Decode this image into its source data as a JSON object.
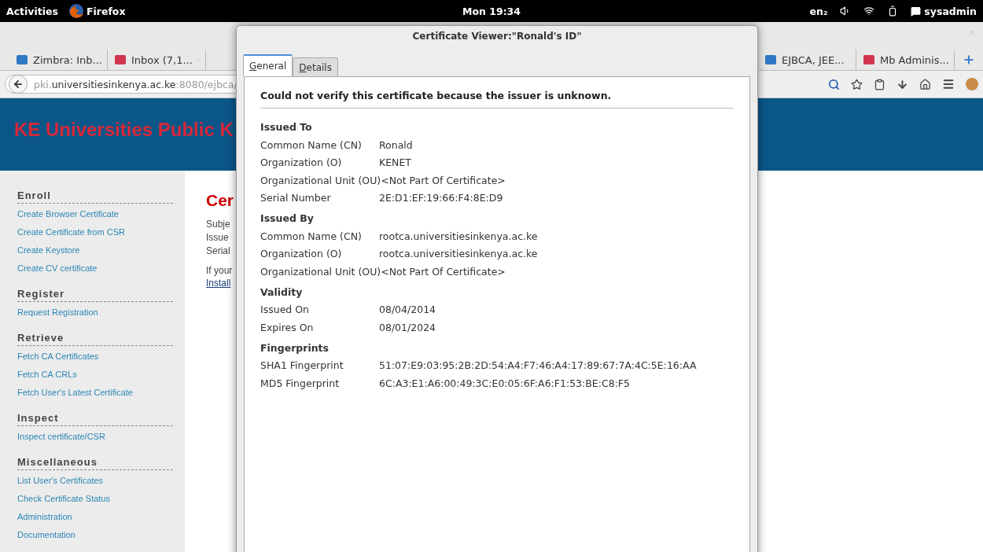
{
  "top_bar": {
    "activities": "Activities",
    "app_name": "Firefox",
    "clock": "Mon 19:34",
    "keyboard_layout": "en₂",
    "user": "sysadmin"
  },
  "browser": {
    "tabs_left": [
      {
        "label": "Zimbra: Inb...",
        "selected": false
      },
      {
        "label": "Inbox (7,1...",
        "selected": false
      }
    ],
    "tabs_right": [
      {
        "label": "EJBCA, JEE...",
        "selected": false
      },
      {
        "label": "Mb Adminis...",
        "selected": false
      }
    ],
    "url": "pki.**universitiesinkenya.ac.ke**:8080/ejbca/"
  },
  "site": {
    "banner_title": "KE Universities Public K",
    "sidebar": [
      {
        "heading": "Enroll",
        "links": [
          "Create Browser Certificate",
          "Create Certificate from CSR",
          "Create Keystore",
          "Create CV certificate"
        ]
      },
      {
        "heading": "Register",
        "links": [
          "Request Registration"
        ]
      },
      {
        "heading": "Retrieve",
        "links": [
          "Fetch CA Certificates",
          "Fetch CA CRLs",
          "Fetch User's Latest Certificate"
        ]
      },
      {
        "heading": "Inspect",
        "links": [
          "Inspect certificate/CSR"
        ]
      },
      {
        "heading": "Miscellaneous",
        "links": [
          "List User's Certificates",
          "Check Certificate Status",
          "Administration",
          "Documentation"
        ]
      }
    ],
    "main": {
      "heading": "Cer",
      "lines": [
        "Subje",
        "Issue",
        "Serial"
      ],
      "note": "If your",
      "link": "Install"
    }
  },
  "dialog": {
    "title": "Certificate Viewer:\"Ronald's ID\"",
    "tabs": [
      {
        "label": "General",
        "selected": true
      },
      {
        "label": "Details",
        "selected": false
      }
    ],
    "message": "Could not verify this certificate because the issuer is unknown.",
    "sections": [
      {
        "heading": "Issued To",
        "rows": [
          {
            "label": "Common Name (CN)",
            "value": "Ronald"
          },
          {
            "label": "Organization (O)",
            "value": "KENET"
          },
          {
            "label": "Organizational Unit (OU)",
            "value": "<Not Part Of Certificate>"
          },
          {
            "label": "Serial Number",
            "value": "2E:D1:EF:19:66:F4:8E:D9"
          }
        ]
      },
      {
        "heading": "Issued By",
        "rows": [
          {
            "label": "Common Name (CN)",
            "value": "rootca.universitiesinkenya.ac.ke"
          },
          {
            "label": "Organization (O)",
            "value": "rootca.universitiesinkenya.ac.ke"
          },
          {
            "label": "Organizational Unit (OU)",
            "value": "<Not Part Of Certificate>"
          }
        ]
      },
      {
        "heading": "Validity",
        "rows": [
          {
            "label": "Issued On",
            "value": "08/04/2014"
          },
          {
            "label": "Expires On",
            "value": "08/01/2024"
          }
        ]
      },
      {
        "heading": "Fingerprints",
        "rows": [
          {
            "label": "SHA1 Fingerprint",
            "value": "51:07:E9:03:95:2B:2D:54:A4:F7:46:A4:17:89:67:7A:4C:5E:16:AA"
          },
          {
            "label": "MD5 Fingerprint",
            "value": "6C:A3:E1:A6:00:49:3C:E0:05:6F:A6:F1:53:BE:C8:F5"
          }
        ]
      }
    ]
  }
}
